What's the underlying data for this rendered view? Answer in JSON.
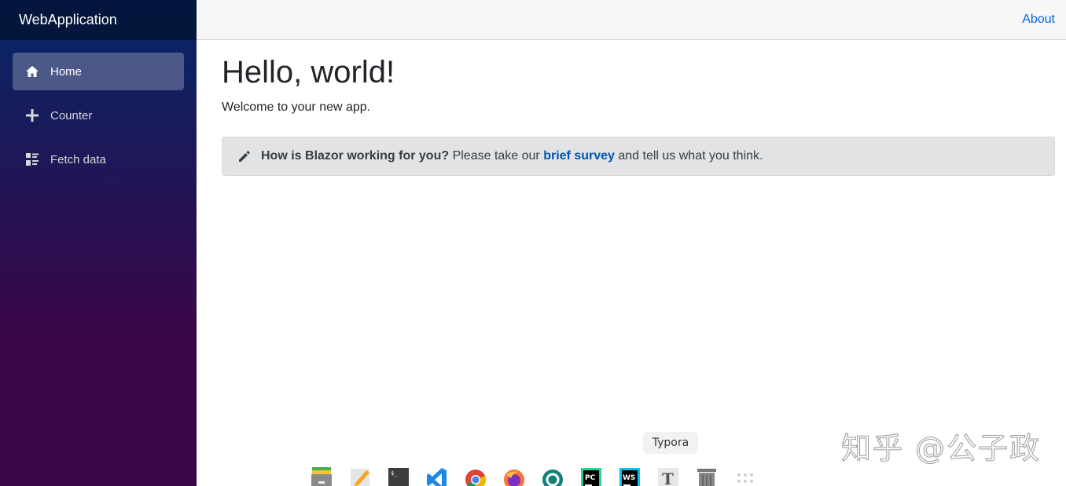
{
  "sidebar": {
    "brand": "WebApplication",
    "items": [
      {
        "label": "Home",
        "icon": "home-icon",
        "active": true
      },
      {
        "label": "Counter",
        "icon": "plus-icon",
        "active": false
      },
      {
        "label": "Fetch data",
        "icon": "list-icon",
        "active": false
      }
    ]
  },
  "top_row": {
    "about_label": "About"
  },
  "main": {
    "title": "Hello, world!",
    "welcome": "Welcome to your new app.",
    "alert": {
      "question": "How is Blazor working for you?",
      "text_before": " Please take our ",
      "link_label": "brief survey",
      "text_after": " and tell us what you think."
    }
  },
  "dock": {
    "tooltip": "Typora",
    "apps": [
      "archive-manager",
      "text-editor",
      "terminal",
      "vscode",
      "chrome",
      "firefox",
      "camera-app",
      "pycharm",
      "webstorm",
      "typora",
      "trash",
      "app-grid"
    ]
  },
  "watermark": "知乎 @公子政",
  "colors": {
    "sidebar_top": "#052767",
    "sidebar_bottom": "#3a0647",
    "link": "#0366d6",
    "alert_bg": "#e2e3e5"
  }
}
